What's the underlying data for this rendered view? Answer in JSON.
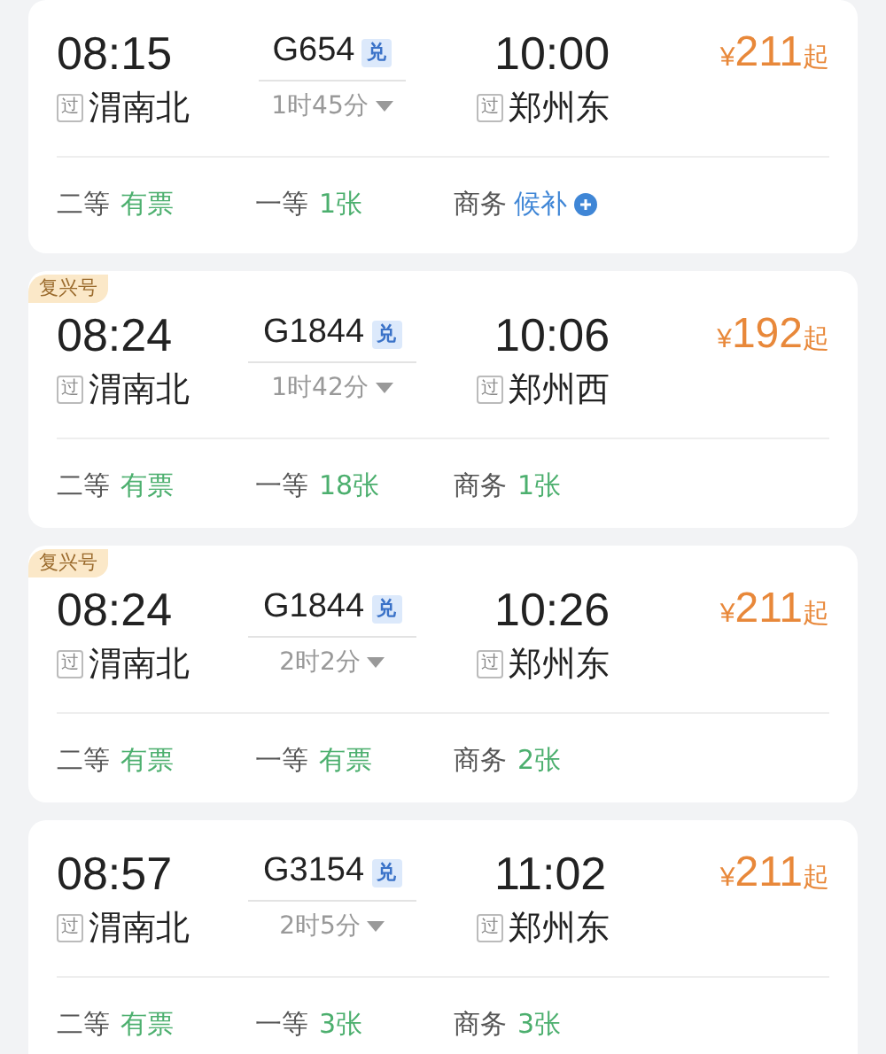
{
  "trains": [
    {
      "depart_time": "08:15",
      "depart_badge": "过",
      "depart_station": "渭南北",
      "train_no": "G654",
      "exchange_badge": "兑",
      "duration": "1时45分",
      "arrive_time": "10:00",
      "arrive_badge": "过",
      "arrive_station": "郑州东",
      "price_symbol": "¥",
      "price": "211",
      "price_suffix": "起",
      "seats": [
        {
          "class": "二等",
          "status": "有票",
          "kind": "available"
        },
        {
          "class": "一等",
          "status": "1张",
          "kind": "available"
        },
        {
          "class": "商务",
          "status": "候补",
          "kind": "waitlist"
        }
      ]
    },
    {
      "tag": "复兴号",
      "depart_time": "08:24",
      "depart_badge": "过",
      "depart_station": "渭南北",
      "train_no": "G1844",
      "exchange_badge": "兑",
      "duration": "1时42分",
      "arrive_time": "10:06",
      "arrive_badge": "过",
      "arrive_station": "郑州西",
      "price_symbol": "¥",
      "price": "192",
      "price_suffix": "起",
      "seats": [
        {
          "class": "二等",
          "status": "有票",
          "kind": "available"
        },
        {
          "class": "一等",
          "status": "18张",
          "kind": "available"
        },
        {
          "class": "商务",
          "status": "1张",
          "kind": "available"
        }
      ]
    },
    {
      "tag": "复兴号",
      "depart_time": "08:24",
      "depart_badge": "过",
      "depart_station": "渭南北",
      "train_no": "G1844",
      "exchange_badge": "兑",
      "duration": "2时2分",
      "arrive_time": "10:26",
      "arrive_badge": "过",
      "arrive_station": "郑州东",
      "price_symbol": "¥",
      "price": "211",
      "price_suffix": "起",
      "seats": [
        {
          "class": "二等",
          "status": "有票",
          "kind": "available"
        },
        {
          "class": "一等",
          "status": "有票",
          "kind": "available"
        },
        {
          "class": "商务",
          "status": "2张",
          "kind": "available"
        }
      ]
    },
    {
      "depart_time": "08:57",
      "depart_badge": "过",
      "depart_station": "渭南北",
      "train_no": "G3154",
      "exchange_badge": "兑",
      "duration": "2时5分",
      "arrive_time": "11:02",
      "arrive_badge": "过",
      "arrive_station": "郑州东",
      "price_symbol": "¥",
      "price": "211",
      "price_suffix": "起",
      "seats": [
        {
          "class": "二等",
          "status": "有票",
          "kind": "available"
        },
        {
          "class": "一等",
          "status": "3张",
          "kind": "available"
        },
        {
          "class": "商务",
          "status": "3张",
          "kind": "available"
        }
      ]
    }
  ]
}
